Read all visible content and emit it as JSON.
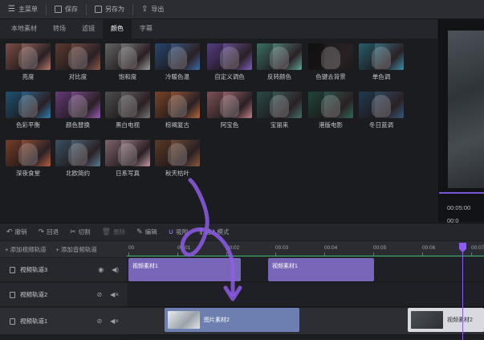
{
  "toolbar": {
    "main_menu": "主菜单",
    "save": "保存",
    "save_as": "另存为",
    "export": "导出"
  },
  "tabs": [
    {
      "label": "本地素材",
      "active": false
    },
    {
      "label": "转场",
      "active": false
    },
    {
      "label": "滤镜",
      "active": false
    },
    {
      "label": "颜色",
      "active": true
    },
    {
      "label": "字幕",
      "active": false
    }
  ],
  "filters": [
    {
      "label": "亮度",
      "tint": "#b8796a"
    },
    {
      "label": "对比度",
      "tint": "#8f5a4c"
    },
    {
      "label": "饱和度",
      "tint": "#9a9a9a"
    },
    {
      "label": "冷暖色温",
      "tint": "#3e6ca8"
    },
    {
      "label": "自定义调色",
      "tint": "#7e5fc4"
    },
    {
      "label": "反转颜色",
      "tint": "#5ea79a"
    },
    {
      "label": "色键去背景",
      "tint": "#1a1a1a"
    },
    {
      "label": "单色调",
      "tint": "#3d8ea6"
    },
    {
      "label": "色彩平衡",
      "tint": "#2f7fb0"
    },
    {
      "label": "颜色替换",
      "tint": "#9a5bb8"
    },
    {
      "label": "黑白电视",
      "tint": "#777777"
    },
    {
      "label": "棕褐复古",
      "tint": "#b86a3c"
    },
    {
      "label": "阿宝色",
      "tint": "#c07f85"
    },
    {
      "label": "宝丽来",
      "tint": "#44706e"
    },
    {
      "label": "港版电影",
      "tint": "#2f6a58"
    },
    {
      "label": "冬日蓝调",
      "tint": "#34597c"
    },
    {
      "label": "深夜食堂",
      "tint": "#b6603e"
    },
    {
      "label": "北欧简约",
      "tint": "#5a7c93"
    },
    {
      "label": "日系写真",
      "tint": "#c19aa5"
    },
    {
      "label": "秋天枯叶",
      "tint": "#8a5a3c"
    }
  ],
  "preview": {
    "time": "00:05:00",
    "time2": "00:0"
  },
  "edit_toolbar": {
    "undo": "撤销",
    "redo": "回退",
    "cut": "切割",
    "delete": "删除",
    "edit": "编辑",
    "magnet": "吸附",
    "insert_mode": "插入模式"
  },
  "add_tracks": {
    "add_video": "+ 添加视频轨道",
    "add_audio": "+ 添加音频轨道"
  },
  "ruler_ticks": [
    "00",
    "00:01",
    "00:02",
    "00:03",
    "00:04",
    "00:05",
    "00:06",
    "00:07"
  ],
  "tracks": [
    {
      "name": "视频轨道3"
    },
    {
      "name": "视频轨道2"
    },
    {
      "name": "视频轨道1"
    }
  ],
  "clips": {
    "v3_a": "视频素材1",
    "v3_b": "视频素材1",
    "v1_a": "图片素材2",
    "v1_b": "视频素材2"
  },
  "colors": {
    "accent": "#8e5cf0",
    "clip_video": "#7a66b8",
    "clip_image": "#6c7fb0",
    "ruler_green": "#3bb567"
  }
}
